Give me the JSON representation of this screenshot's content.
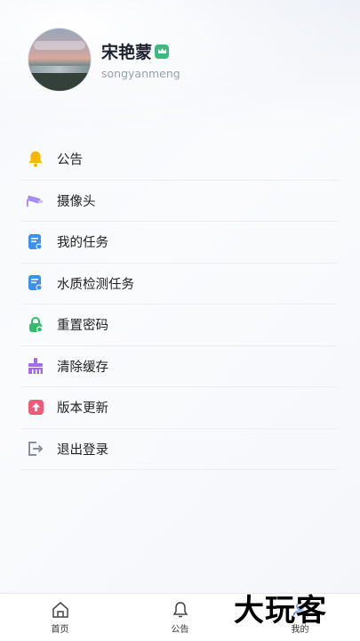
{
  "profile": {
    "name": "宋艳蒙",
    "account": "songyanmeng",
    "badge_icon": "vip-crown-icon",
    "badge_color": "#3dbb7e"
  },
  "menu": {
    "items": [
      {
        "label": "公告",
        "icon": "bell-icon",
        "color": "#f5b800"
      },
      {
        "label": "摄像头",
        "icon": "camera-icon",
        "color": "#a58af0"
      },
      {
        "label": "我的任务",
        "icon": "task-doc-icon",
        "color": "#3d8ff0"
      },
      {
        "label": "水质检测任务",
        "icon": "water-test-doc-icon",
        "color": "#3d8ff0"
      },
      {
        "label": "重置密码",
        "icon": "lock-icon",
        "color": "#2fbf6a"
      },
      {
        "label": "清除缓存",
        "icon": "broom-icon",
        "color": "#a06ee8"
      },
      {
        "label": "版本更新",
        "icon": "upload-icon",
        "color": "#ee5a78"
      },
      {
        "label": "退出登录",
        "icon": "logout-icon",
        "color": "#8a8f99"
      }
    ]
  },
  "tabbar": {
    "tabs": [
      {
        "label": "首页",
        "icon": "home-icon"
      },
      {
        "label": "公告",
        "icon": "bell-icon"
      },
      {
        "label": "我的",
        "icon": "user-icon"
      }
    ]
  },
  "watermark": "大玩客"
}
